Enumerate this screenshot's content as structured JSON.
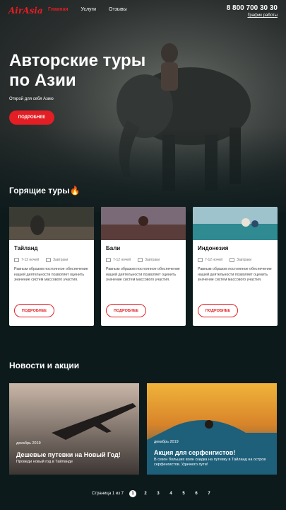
{
  "header": {
    "logo": "AirAsia",
    "nav": [
      "Главная",
      "Услуги",
      "Отзывы"
    ],
    "phone": "8 800 700 30 30",
    "schedule": "График работы"
  },
  "hero": {
    "title": "Авторские туры по Азии",
    "subtitle": "Открой для себя Азию",
    "button": "ПОДРОБНЕЕ"
  },
  "hot_tours": {
    "title": "Горящие туры",
    "icon": "fire-icon",
    "cards": [
      {
        "name": "Тайланд",
        "nights": "7-12 ночей",
        "meal": "Завтраки",
        "desc": "Равным образом постоянное обеспечение нашей деятельности позволяет оценить значение систем массового участия.",
        "button": "ПОДРОБНЕЕ"
      },
      {
        "name": "Бали",
        "nights": "7-12 ночей",
        "meal": "Завтраки",
        "desc": "Равным образом постоянное обеспечение нашей деятельности позволяет оценить значение систем массового участия.",
        "button": "ПОДРОБНЕЕ"
      },
      {
        "name": "Индонезия",
        "nights": "7-12 ночей",
        "meal": "Завтраки",
        "desc": "Равным образом постоянное обеспечение нашей деятельности позволяет оценить значение систем массового участия.",
        "button": "ПОДРОБНЕЕ"
      }
    ]
  },
  "news": {
    "title": "Новости и акции",
    "items": [
      {
        "date": "декабрь 2019",
        "title": "Дешевые путевки на Новый Год!",
        "text": "Проведи новый год в Тайланде"
      },
      {
        "date": "декабрь 2019",
        "title": "Акция для серфенгистов!",
        "text": "В сезон больших волн скидка на путевку в Тайланд на остров серфенгистов. Удачного пути!"
      }
    ]
  },
  "pager": {
    "label": "Страница 1 из 7",
    "pages": [
      "1",
      "2",
      "3",
      "4",
      "5",
      "6",
      "7"
    ],
    "current": "1"
  },
  "colors": {
    "accent": "#e31e24",
    "background": "#0c1a1c"
  }
}
